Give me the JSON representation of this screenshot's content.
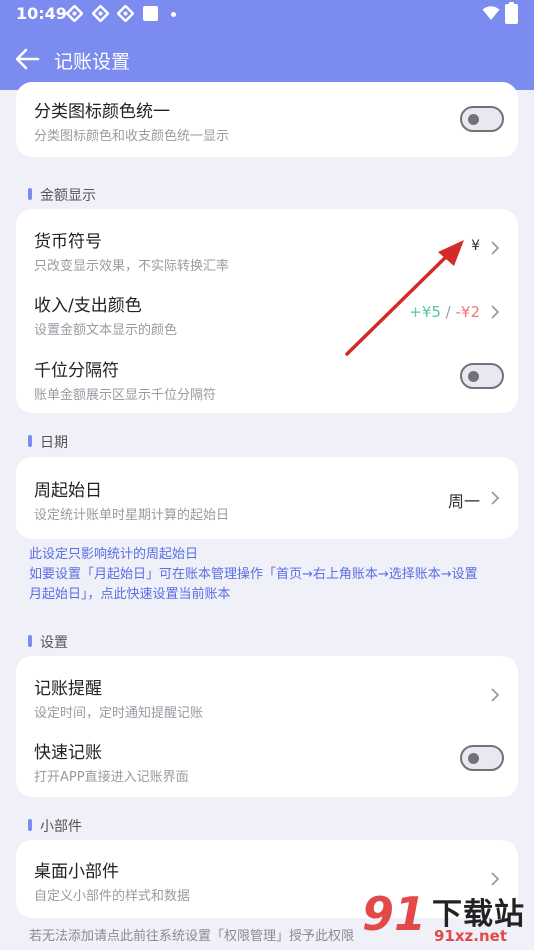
{
  "status_bar": {
    "time": "10:49"
  },
  "app_bar": {
    "title": "记账设置"
  },
  "sections": {
    "top": {
      "unify_icon_color": {
        "title": "分类图标颜色统一",
        "subtitle": "分类图标颜色和收支颜色统一显示",
        "toggle_on": false
      }
    },
    "amount": {
      "label": "金额显示",
      "currency": {
        "title": "货币符号",
        "subtitle": "只改变显示效果，不实际转换汇率",
        "value": "¥"
      },
      "income_color": {
        "title": "收入/支出颜色",
        "subtitle": "设置金额文本显示的颜色",
        "income_sample": "+¥5",
        "separator": " / ",
        "expense_sample": "-¥2"
      },
      "thousands": {
        "title": "千位分隔符",
        "subtitle": "账单金额展示区显示千位分隔符",
        "toggle_on": false
      }
    },
    "date": {
      "label": "日期",
      "week_start": {
        "title": "周起始日",
        "subtitle": "设定统计账单时星期计算的起始日",
        "value": "周一"
      },
      "note_line1": "此设定只影响统计的周起始日",
      "note_line2": "如要设置「月起始日」可在账本管理操作「首页→右上角账本→选择账本→设置",
      "note_line3": "月起始日」，点此快速设置当前账本"
    },
    "settings": {
      "label": "设置",
      "reminder": {
        "title": "记账提醒",
        "subtitle": "设定时间，定时通知提醒记账"
      },
      "quick": {
        "title": "快速记账",
        "subtitle": "打开APP直接进入记账界面",
        "toggle_on": false
      }
    },
    "widget": {
      "label": "小部件",
      "desktop_widget": {
        "title": "桌面小部件",
        "subtitle": "自定义小部件的样式和数据"
      },
      "footnote": "若无法添加请点此前往系统设置「权限管理」授予此权限"
    }
  },
  "watermark": {
    "number": "91",
    "text": "下载站",
    "url": "91xz.net"
  },
  "colors": {
    "primary": "#7c8bef",
    "background": "#eff0f8",
    "income": "#5cc79a",
    "expense": "#f07878",
    "annotation_arrow": "#d42a2a"
  }
}
